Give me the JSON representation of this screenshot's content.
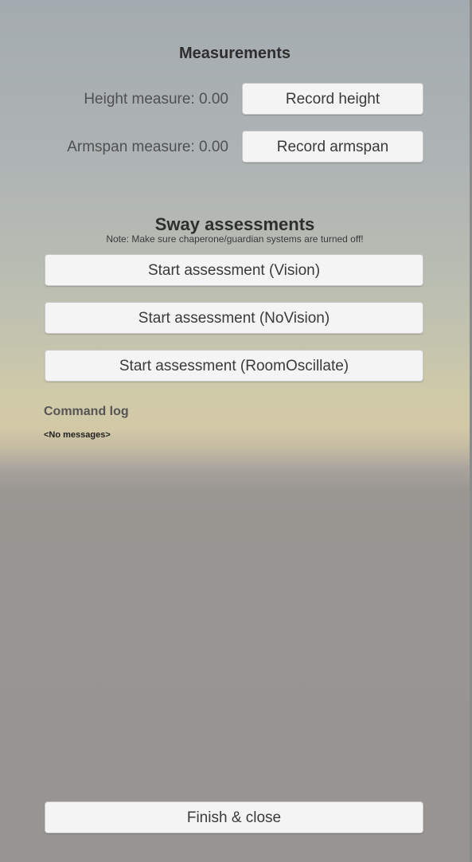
{
  "measurements": {
    "title": "Measurements",
    "height_label": "Height measure: 0.00",
    "record_height_button": "Record height",
    "armspan_label": "Armspan measure: 0.00",
    "record_armspan_button": "Record armspan"
  },
  "sway": {
    "title": "Sway assessments",
    "note": "Note: Make sure chaperone/guardian systems are turned off!",
    "buttons": [
      "Start assessment (Vision)",
      "Start assessment (NoVision)",
      "Start assessment (RoomOscillate)"
    ]
  },
  "command_log": {
    "title": "Command log",
    "message": "<No messages>"
  },
  "footer": {
    "finish_button": "Finish & close"
  }
}
